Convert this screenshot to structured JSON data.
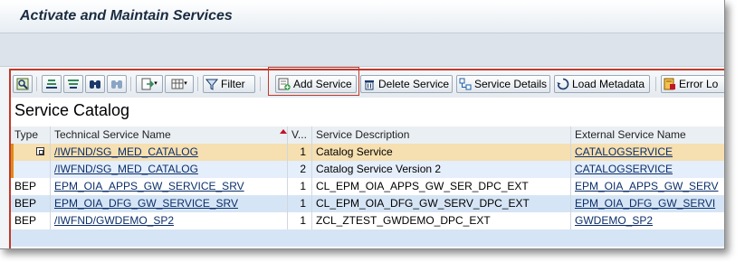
{
  "window": {
    "title": "Activate and Maintain Services"
  },
  "toolbar": {
    "items": [
      {
        "name": "details-icon",
        "label": ""
      },
      {
        "name": "sort-ascending-icon",
        "label": ""
      },
      {
        "name": "sort-descending-icon",
        "label": ""
      },
      {
        "name": "find-icon",
        "label": ""
      },
      {
        "name": "find-next-icon",
        "label": ""
      },
      {
        "name": "export-icon",
        "label": ""
      },
      {
        "name": "layout-icon",
        "label": ""
      },
      {
        "name": "filter-icon",
        "label": "Filter"
      },
      {
        "name": "add-service-icon",
        "label": "Add Service"
      },
      {
        "name": "delete-service-icon",
        "label": "Delete Service"
      },
      {
        "name": "service-details-icon",
        "label": "Service Details"
      },
      {
        "name": "load-metadata-icon",
        "label": "Load Metadata"
      },
      {
        "name": "error-log-icon",
        "label": "Error Lo"
      }
    ]
  },
  "catalog": {
    "title": "Service Catalog",
    "columns": [
      "Type",
      "Technical Service Name",
      "V...",
      "Service Description",
      "External Service Name"
    ],
    "rows": [
      {
        "type": "",
        "tech": "/IWFND/SG_MED_CATALOG",
        "v": "1",
        "desc": "Catalog Service",
        "ext": "CATALOGSERVICE"
      },
      {
        "type": "",
        "tech": "/IWFND/SG_MED_CATALOG",
        "v": "2",
        "desc": "Catalog Service Version 2",
        "ext": "CATALOGSERVICE"
      },
      {
        "type": "BEP",
        "tech": "EPM_OIA_APPS_GW_SERVICE_SRV",
        "v": "1",
        "desc": "CL_EPM_OIA_APPS_GW_SER_DPC_EXT",
        "ext": "EPM_OIA_APPS_GW_SERV"
      },
      {
        "type": "BEP",
        "tech": "EPM_OIA_DFG_GW_SERVICE_SRV",
        "v": "1",
        "desc": "CL_EPM_OIA_DFG_GW_SERV_DPC_EXT",
        "ext": "EPM_OIA_DFG_GW_SERVI"
      },
      {
        "type": "BEP",
        "tech": "/IWFND/GWDEMO_SP2",
        "v": "1",
        "desc": "ZCL_ZTEST_GWDEMO_DPC_EXT",
        "ext": "GWDEMO_SP2"
      }
    ]
  },
  "colors": {
    "highlight": "#c0392b",
    "selected_row": "#f6dfb0",
    "alt_row": "#d6e5f5"
  }
}
